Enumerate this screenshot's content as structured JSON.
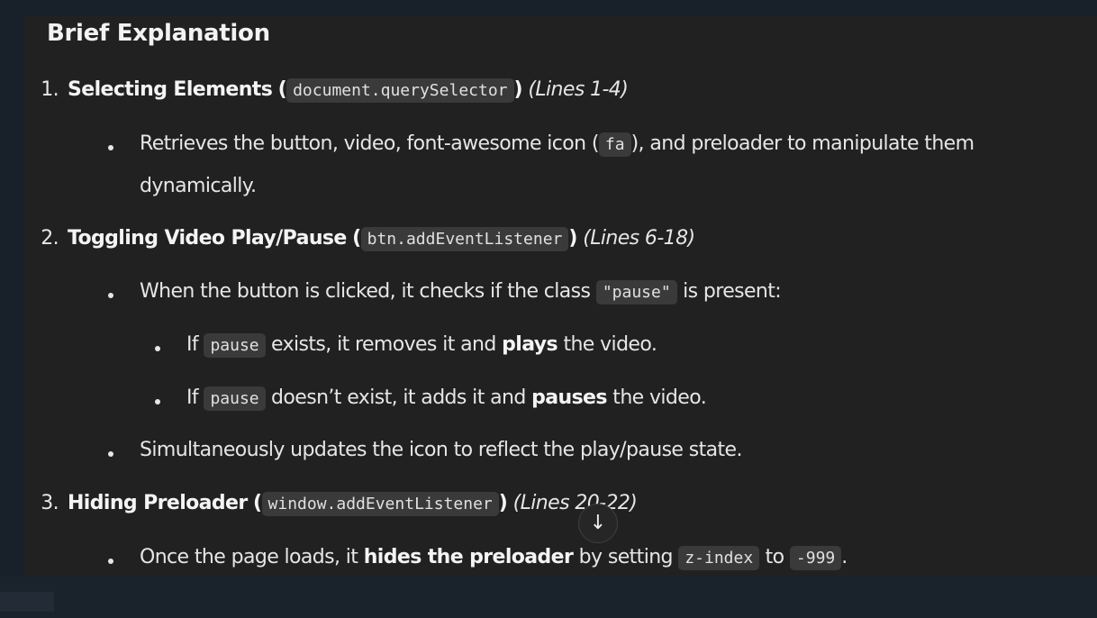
{
  "heading": "Brief Explanation",
  "items": [
    {
      "number": "1.",
      "title": "Selecting Elements",
      "code": "document.querySelector",
      "lines": "(Lines 1-4)"
    },
    {
      "number": "2.",
      "title": "Toggling Video Play/Pause",
      "code": "btn.addEventListener",
      "lines": "(Lines 6-18)"
    },
    {
      "number": "3.",
      "title": "Hiding Preloader",
      "code": "window.addEventListener",
      "lines": "(Lines 20-22)"
    }
  ],
  "bullets": {
    "b1_pre": "Retrieves the button, video, font-awesome icon (",
    "b1_code": "fa",
    "b1_post": "), and preloader to manipulate them",
    "b1_cont": "dynamically.",
    "b2_pre": "When the button is clicked, it checks if the class",
    "b2_code": "\"pause\"",
    "b2_post": "is present:",
    "s1_pre": "If",
    "s1_code": "pause",
    "s1_mid": "exists, it removes it and",
    "s1_bold": "plays",
    "s1_post": "the video.",
    "s2_pre": "If",
    "s2_code": "pause",
    "s2_mid": "doesn’t exist, it adds it and",
    "s2_bold": "pauses",
    "s2_post": "the video.",
    "b3": "Simultaneously updates the icon to reflect the play/pause state.",
    "b4_pre": "Once the page loads, it",
    "b4_bold": "hides the preloader",
    "b4_mid": "by setting",
    "b4_code1": "z-index",
    "b4_to": "to",
    "b4_code2": "-999",
    "b4_end": "."
  },
  "scroll_button_icon": "arrow-down-icon"
}
